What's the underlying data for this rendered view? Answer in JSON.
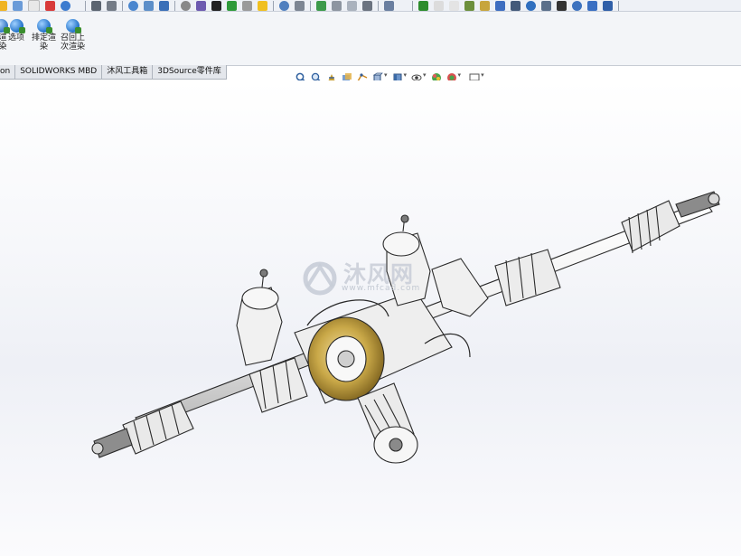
{
  "command_manager": {
    "buttons": [
      {
        "label": "渲\n染"
      },
      {
        "label": "选项"
      },
      {
        "label": "排定渲\n染"
      },
      {
        "label": "召回上\n次渲染"
      }
    ]
  },
  "tabs": [
    {
      "label": "on"
    },
    {
      "label": "SOLIDWORKS MBD"
    },
    {
      "label": "沐风工具箱"
    },
    {
      "label": "3DSource零件库"
    }
  ],
  "hud_icons": [
    "zoom-to-fit-icon",
    "zoom-area-icon",
    "previous-view-icon",
    "section-view-icon",
    "dynamic-annotation-icon",
    "view-orientation-icon",
    "display-style-icon",
    "hide-show-items-icon",
    "edit-appearance-icon",
    "apply-scene-icon",
    "view-settings-icon"
  ],
  "watermark": {
    "main": "沐风网",
    "sub": "www.mfcad.com"
  },
  "colors": {
    "toolbar_bg": "#eef1f6",
    "housing_gold": "#b89a3a",
    "part_white": "#f2f2f2",
    "outline": "#2a2a2a"
  }
}
